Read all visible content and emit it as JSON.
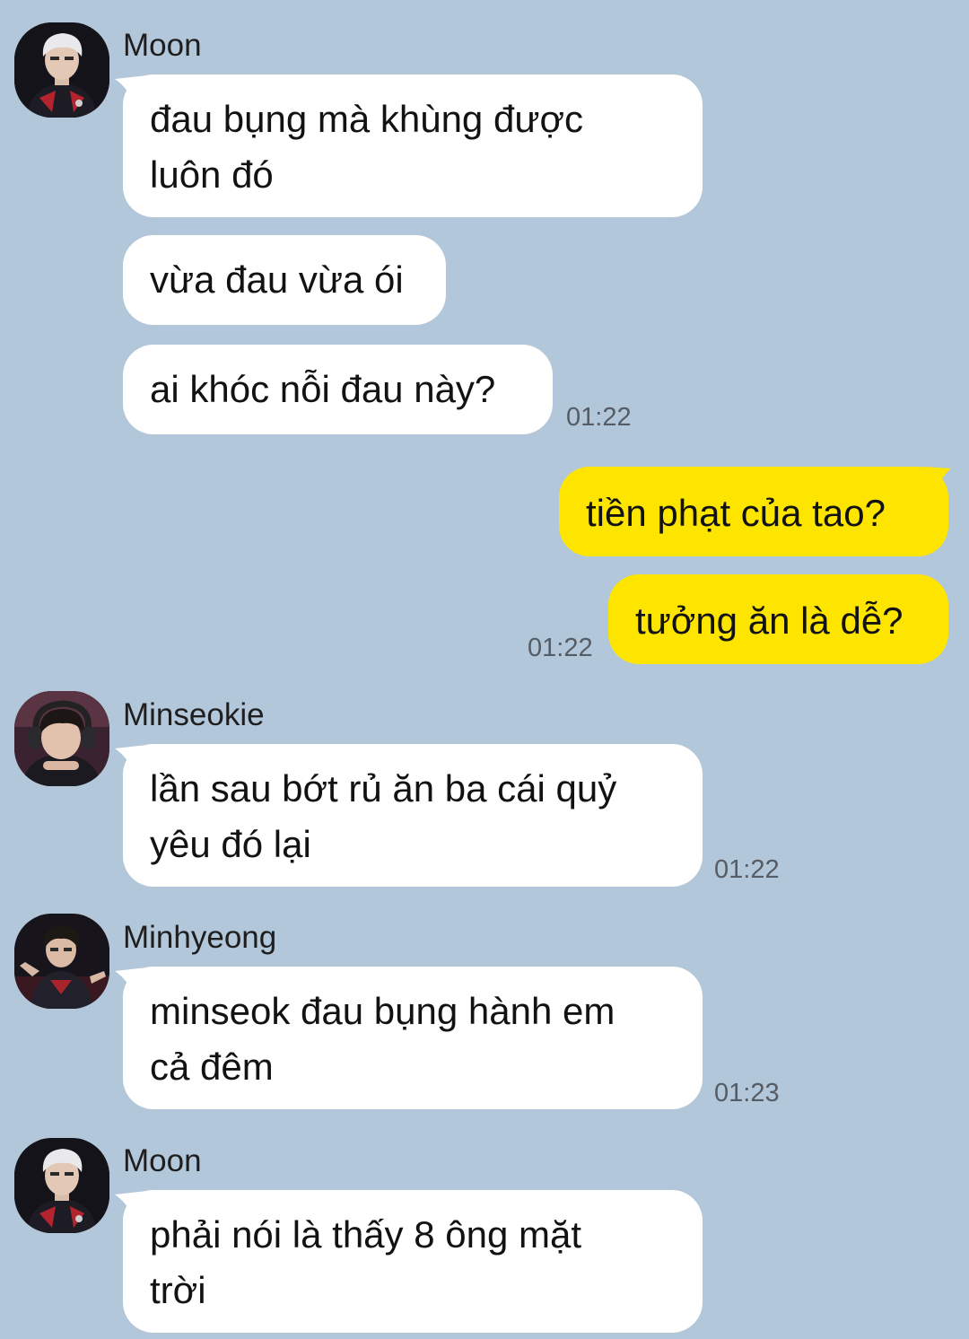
{
  "colors": {
    "background": "#b2c7da",
    "bubble_in": "#ffffff",
    "bubble_out": "#fee500",
    "timestamp": "#565c63"
  },
  "groups": [
    {
      "sender": "Moon",
      "avatar": "avatar-photo-moon",
      "messages": [
        {
          "lines": [
            "đau bụng mà khùng được",
            "luôn đó"
          ]
        },
        {
          "lines": [
            "vừa đau vừa ói"
          ]
        },
        {
          "lines": [
            "ai khóc nỗi đau này?"
          ],
          "time": "01:22"
        }
      ]
    },
    {
      "sender": "",
      "outgoing": true,
      "messages": [
        {
          "lines": [
            "tiền phạt của tao?"
          ]
        },
        {
          "lines": [
            "tưởng ăn là dễ?"
          ],
          "time": "01:22"
        }
      ]
    },
    {
      "sender": "Minseokie",
      "avatar": "avatar-photo-minseokie",
      "messages": [
        {
          "lines": [
            "lần sau bớt rủ ăn ba cái quỷ",
            "yêu đó lại"
          ],
          "time": "01:22"
        }
      ]
    },
    {
      "sender": "Minhyeong",
      "avatar": "avatar-photo-minhyeong",
      "messages": [
        {
          "lines": [
            "minseok đau bụng hành em",
            "cả đêm"
          ],
          "time": "01:23"
        }
      ]
    },
    {
      "sender": "Moon",
      "avatar": "avatar-photo-moon",
      "messages": [
        {
          "lines": [
            "phải nói là thấy 8 ông mặt",
            "trời"
          ]
        }
      ]
    }
  ]
}
